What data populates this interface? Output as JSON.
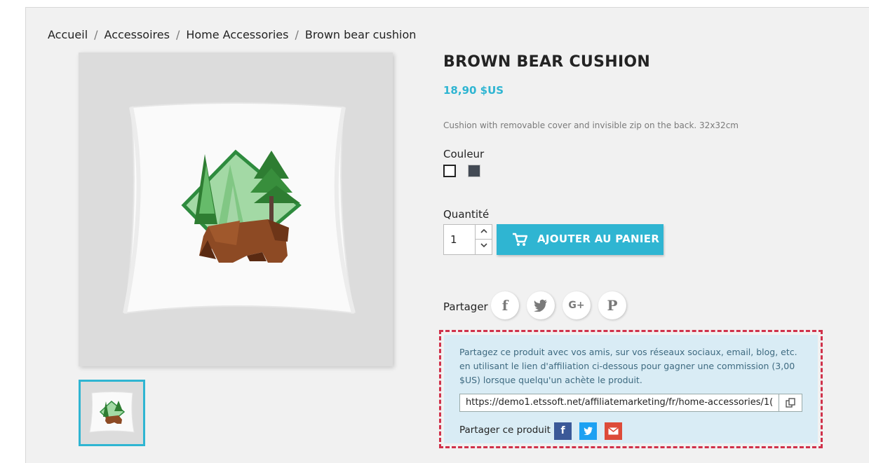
{
  "breadcrumb": [
    "Accueil",
    "Accessoires",
    "Home Accessories",
    "Brown bear cushion"
  ],
  "breadcrumb_separator": "/",
  "product": {
    "title": "BROWN BEAR CUSHION",
    "price": "18,90 $US",
    "description": "Cushion with removable cover and invisible zip on the back. 32x32cm",
    "color_label": "Couleur",
    "colors": [
      {
        "name": "white",
        "hex": "#ffffff",
        "selected": true
      },
      {
        "name": "dark-grey",
        "hex": "#434a54",
        "selected": false
      }
    ],
    "quantity_label": "Quantité",
    "quantity_value": "1",
    "add_to_cart": "AJOUTER AU PANIER",
    "share_label": "Partager",
    "share_icons": [
      "facebook-icon",
      "twitter-icon",
      "googleplus-icon",
      "pinterest-icon"
    ]
  },
  "affiliate": {
    "message": "Partagez ce produit avec vos amis, sur vos réseaux sociaux, email, blog, etc. en utilisant le lien d'affiliation ci-dessous pour gagner une commission (3,00 $US) lorsque quelqu'un achète le produit.",
    "url": "https://demo1.etssoft.net/affiliatemarketing/fr/home-accessories/1(",
    "share_label": "Partager ce produit",
    "share_icons": [
      "facebook-icon",
      "twitter-icon",
      "email-icon"
    ]
  },
  "colors": {
    "accent": "#2fb5d2",
    "highlight_border": "#d0314a",
    "facebook": "#3b5998",
    "twitter": "#1da1f2",
    "email": "#dd4b39"
  }
}
